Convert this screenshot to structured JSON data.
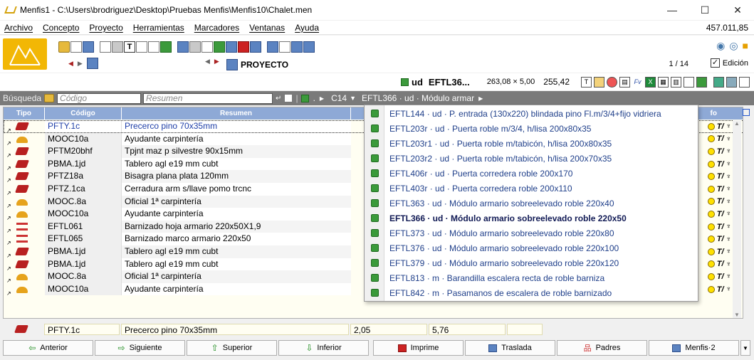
{
  "window": {
    "title": "Menfis1 - C:\\Users\\brodriguez\\Desktop\\Pruebas Menfis\\Menfis10\\Chalet.men",
    "minimize": "—",
    "maximize": "☐",
    "close": "✕"
  },
  "menu": {
    "items": [
      "Archivo",
      "Concepto",
      "Proyecto",
      "Herramientas",
      "Marcadores",
      "Ventanas",
      "Ayuda"
    ],
    "total": "457.011,85"
  },
  "toolbar": {
    "proyecto_label": "PROYECTO",
    "pager": "1 / 14",
    "edicion_label": "Edición",
    "edicion_checked": "✓"
  },
  "concept": {
    "unit": "ud",
    "code": "EFTL36...",
    "dims": "263,08 × 5,00",
    "value": "255,42"
  },
  "search": {
    "label": "Búsqueda",
    "code_placeholder": "Código",
    "summary_placeholder": "Resumen",
    "path_dot": ".",
    "path_c14": "C14",
    "path_current": "EFTL366 · ud · Módulo armar"
  },
  "grid": {
    "headers": {
      "tipo": "Tipo",
      "codigo": "Código",
      "resumen": "Resumen",
      "info": "fo"
    },
    "rows": [
      {
        "type": "brick",
        "code": "PFTY.1c",
        "summary": "Precerco pino 70x35mm",
        "selected": true
      },
      {
        "type": "worker",
        "code": "MOOC10a",
        "summary": "Ayudante carpintería"
      },
      {
        "type": "brick",
        "code": "PFTM20bhf",
        "summary": "Tpjnt maz p silvestre 90x15mm"
      },
      {
        "type": "brick",
        "code": "PBMA.1jd",
        "summary": "Tablero agl e19 mm cubt"
      },
      {
        "type": "brick",
        "code": "PFTZ18a",
        "summary": "Bisagra plana plata 120mm"
      },
      {
        "type": "brick",
        "code": "PFTZ.1ca",
        "summary": "Cerradura arm s/llave pomo trcnc"
      },
      {
        "type": "worker",
        "code": "MOOC.8a",
        "summary": "Oficial 1ª carpintería"
      },
      {
        "type": "worker",
        "code": "MOOC10a",
        "summary": "Ayudante carpintería"
      },
      {
        "type": "tree",
        "code": "EFTL061",
        "summary": "Barnizado hoja armario 220x50X1,9"
      },
      {
        "type": "tree",
        "code": "EFTL065",
        "summary": "Barnizado marco armario 220x50"
      },
      {
        "type": "brick",
        "code": "PBMA.1jd",
        "summary": "Tablero agl e19 mm cubt"
      },
      {
        "type": "brick",
        "code": "PBMA.1jd",
        "summary": "Tablero agl e19 mm cubt"
      },
      {
        "type": "worker",
        "code": "MOOC.8a",
        "summary": "Oficial 1ª carpintería"
      },
      {
        "type": "worker",
        "code": "MOOC10a",
        "summary": "Ayudante carpintería"
      }
    ]
  },
  "summary_row": {
    "code": "PFTY.1c",
    "summary": "Precerco pino 70x35mm",
    "qty": "2,05",
    "price": "5,76"
  },
  "popup": {
    "items": [
      {
        "text": "EFTL144 · ud · P. entrada (130x220) blindada pino Fl.m/3/4+fijo vidriera"
      },
      {
        "text": "EFTL203r · ud · Puerta roble m/3/4, h/lisa 200x80x35"
      },
      {
        "text": "EFTL203r1 · ud · Puerta roble m/tabicón, h/lisa 200x80x35"
      },
      {
        "text": "EFTL203r2 · ud · Puerta roble m/tabicón, h/lisa 200x70x35"
      },
      {
        "text": "EFTL406r · ud · Puerta corredera roble 200x170"
      },
      {
        "text": "EFTL403r · ud · Puerta corredera roble 200x110"
      },
      {
        "text": "EFTL363 · ud · Módulo armario sobreelevado roble 220x40"
      },
      {
        "text": "EFTL366 · ud · Módulo armario sobreelevado roble 220x50",
        "bold": true
      },
      {
        "text": "EFTL373 · ud · Módulo armario sobreelevado roble 220x80"
      },
      {
        "text": "EFTL376 · ud · Módulo armario sobreelevado roble 220x100"
      },
      {
        "text": "EFTL379 · ud · Módulo armario sobreelevado roble 220x120"
      },
      {
        "text": "EFTL813 · m · Barandilla escalera recta de roble barniza"
      },
      {
        "text": "EFTL842 · m · Pasamanos de escalera de roble barnizado"
      }
    ]
  },
  "buttons": {
    "anterior": "Anterior",
    "siguiente": "Siguiente",
    "superior": "Superior",
    "inferior": "Inferior",
    "imprime": "Imprime",
    "traslada": "Traslada",
    "padres": "Padres",
    "menfis2": "Menfis·2"
  }
}
